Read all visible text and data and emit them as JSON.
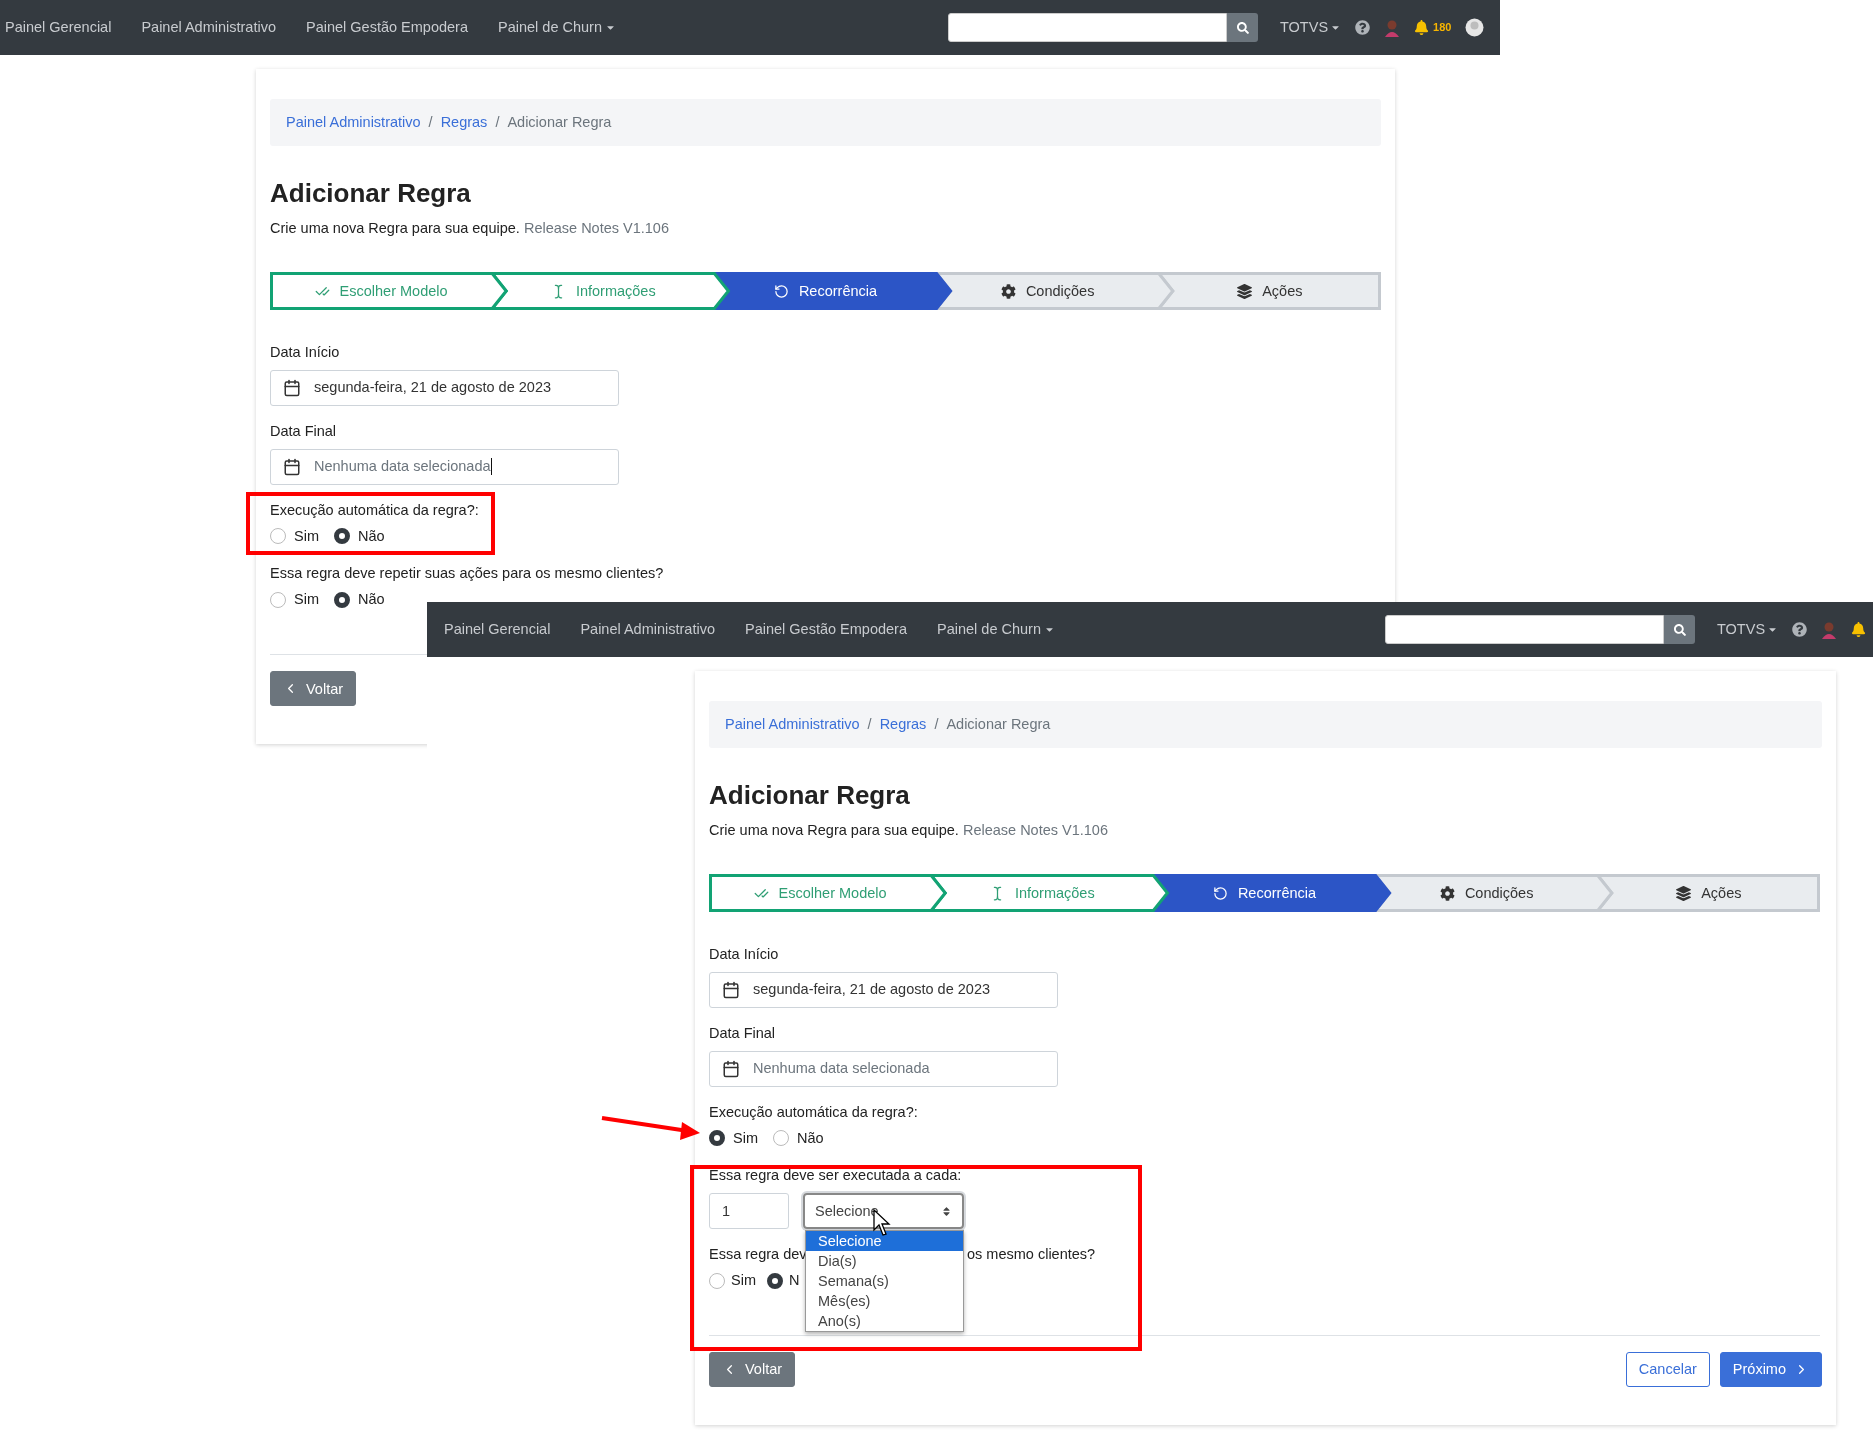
{
  "screenshots": [
    {
      "navbar": {
        "links": [
          {
            "label": "Painel Gerencial",
            "dropdown": false
          },
          {
            "label": "Painel Administrativo",
            "dropdown": false
          },
          {
            "label": "Painel Gestão Empodera",
            "dropdown": false
          },
          {
            "label": "Painel de Churn",
            "dropdown": true
          }
        ],
        "account": "TOTVS",
        "notification_count": "180"
      },
      "breadcrumb": [
        {
          "label": "Painel Administrativo",
          "link": true
        },
        {
          "separator": "/",
          "label": "Regras",
          "link": true
        },
        {
          "separator": "/",
          "label": "Adicionar Regra",
          "link": false
        }
      ],
      "title": "Adicionar Regra",
      "subtitle": "Crie uma nova Regra para sua equipe.",
      "release_notes": "Release Notes V1.106",
      "steps": [
        {
          "label": "Escolher Modelo",
          "done": true,
          "active": false
        },
        {
          "label": "Informações",
          "done": true,
          "active": false
        },
        {
          "label": "Recorrência",
          "done": false,
          "active": true
        },
        {
          "label": "Condições",
          "done": false,
          "active": false
        },
        {
          "label": "Ações",
          "done": false,
          "active": false
        }
      ],
      "form": [
        {
          "kind": "date",
          "label": "Data Início",
          "value": "segunda-feira, 21 de agosto de 2023"
        },
        {
          "kind": "date",
          "label": "Data Final",
          "placeholder": "Nenhuma data selecionada",
          "focused": true
        },
        {
          "kind": "radio",
          "label": "Execução automática da regra?:",
          "options": [
            {
              "label": "Sim",
              "selected": false
            },
            {
              "label": "Não",
              "selected": true
            }
          ]
        },
        {
          "kind": "radio",
          "label": "Essa regra deve repetir suas ações para os mesmo clientes?",
          "options": [
            {
              "label": "Sim",
              "selected": false
            },
            {
              "label": "Não",
              "selected": true
            }
          ]
        }
      ],
      "buttons": [
        {
          "label": "Voltar",
          "kind": "back"
        }
      ]
    },
    {
      "navbar": {
        "links": [
          {
            "label": "Painel Gerencial",
            "dropdown": false
          },
          {
            "label": "Painel Administrativo",
            "dropdown": false
          },
          {
            "label": "Painel Gestão Empodera",
            "dropdown": false
          },
          {
            "label": "Painel de Churn",
            "dropdown": true
          }
        ],
        "account": "TOTVS"
      },
      "breadcrumb": [
        {
          "label": "Painel Administrativo",
          "link": true
        },
        {
          "separator": "/",
          "label": "Regras",
          "link": true
        },
        {
          "separator": "/",
          "label": "Adicionar Regra",
          "link": false
        }
      ],
      "title": "Adicionar Regra",
      "subtitle": "Crie uma nova Regra para sua equipe.",
      "release_notes": "Release Notes V1.106",
      "steps": [
        {
          "label": "Escolher Modelo",
          "done": true,
          "active": false
        },
        {
          "label": "Informações",
          "done": true,
          "active": false
        },
        {
          "label": "Recorrência",
          "done": false,
          "active": true
        },
        {
          "label": "Condições",
          "done": false,
          "active": false
        },
        {
          "label": "Ações",
          "done": false,
          "active": false
        }
      ],
      "form": [
        {
          "kind": "date",
          "label": "Data Início",
          "value": "segunda-feira, 21 de agosto de 2023"
        },
        {
          "kind": "date",
          "label": "Data Final",
          "placeholder": "Nenhuma data selecionada",
          "focused": false
        },
        {
          "kind": "radio",
          "label": "Execução automática da regra?:",
          "options": [
            {
              "label": "Sim",
              "selected": true
            },
            {
              "label": "Não",
              "selected": false
            }
          ]
        },
        {
          "kind": "interval",
          "label": "Essa regra deve ser executada a cada:",
          "count": "1",
          "select_value": "Selecione",
          "options": [
            {
              "label": "Selecione",
              "selected": true
            },
            {
              "label": "Dia(s)",
              "selected": false
            },
            {
              "label": "Semana(s)",
              "selected": false
            },
            {
              "label": "Mês(es)",
              "selected": false
            },
            {
              "label": "Ano(s)",
              "selected": false
            }
          ]
        },
        {
          "kind": "covered_radio",
          "label_start": "Essa regra dev",
          "label_end": "os mesmo clientes?",
          "options": [
            {
              "label": "Sim",
              "selected": false
            },
            {
              "label": "N",
              "selected": true
            }
          ]
        }
      ],
      "buttons": [
        {
          "label": "Voltar",
          "kind": "back"
        },
        {
          "label": "Cancelar",
          "kind": "cancel"
        },
        {
          "label": "Próximo",
          "kind": "next"
        }
      ]
    }
  ]
}
